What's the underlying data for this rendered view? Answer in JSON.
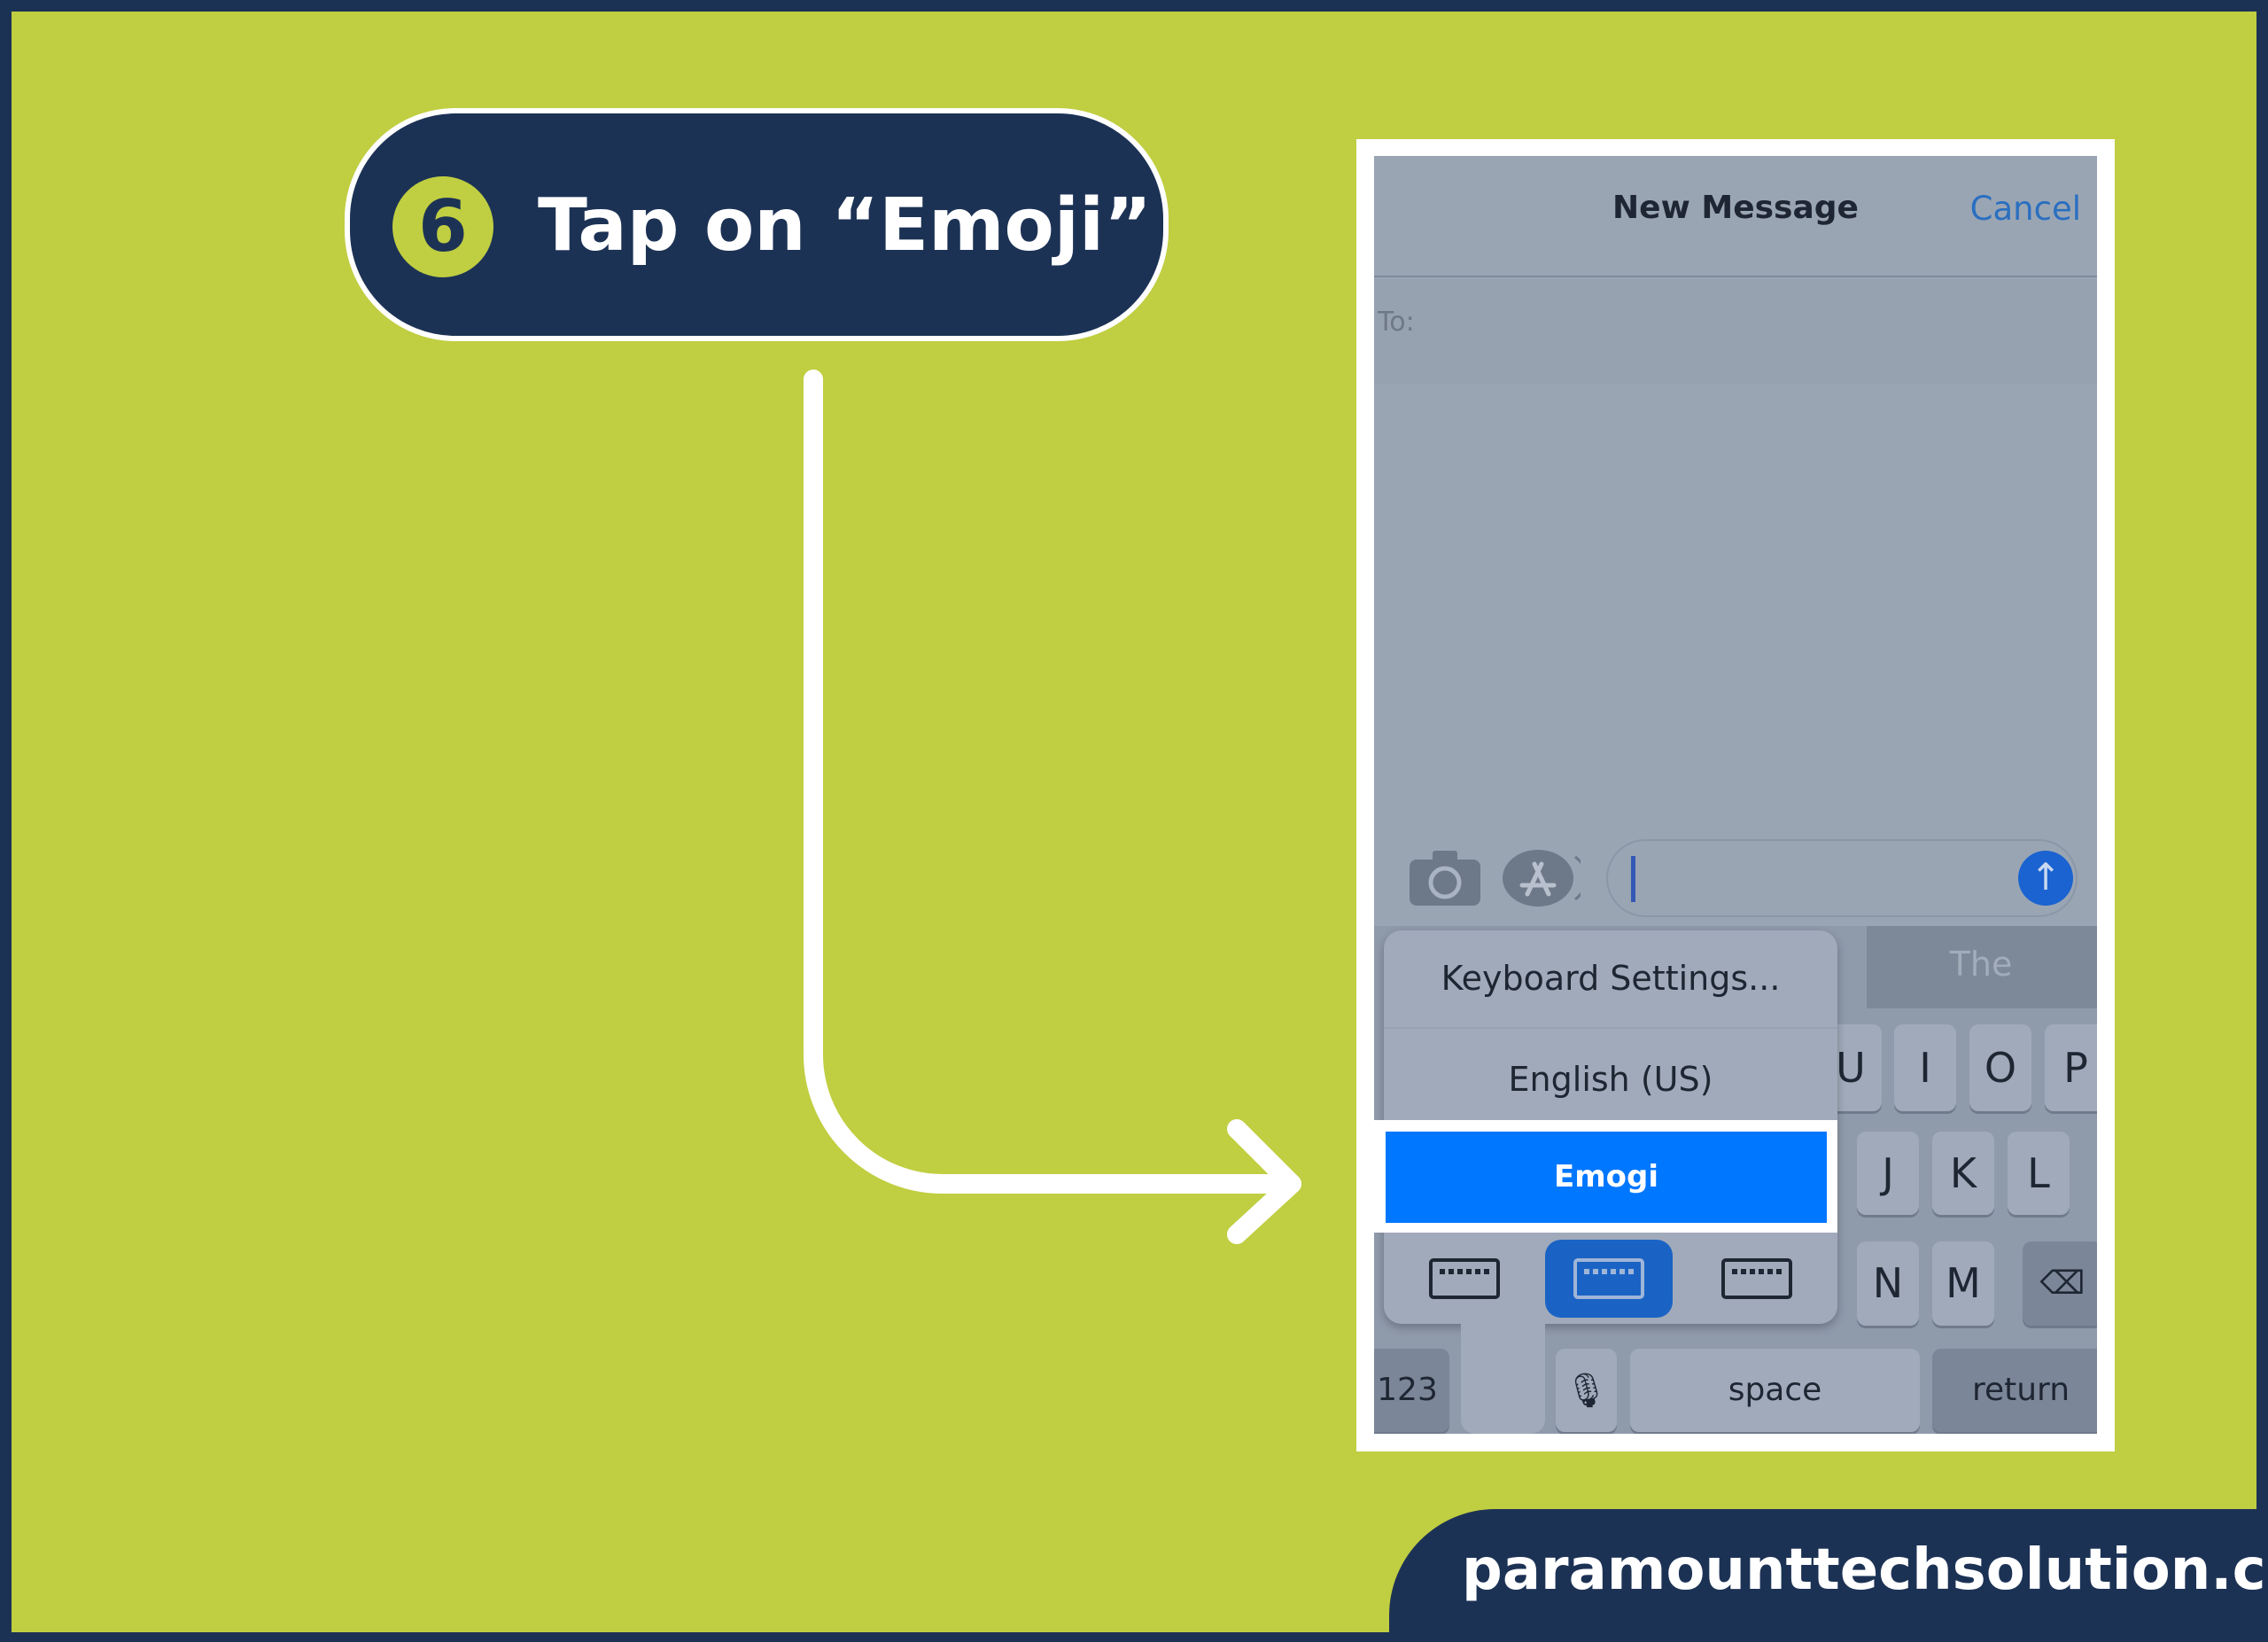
{
  "colors": {
    "background": "#c0ce41",
    "navy": "#1c3255",
    "highlight": "#0077ff"
  },
  "step": {
    "number": "6",
    "instruction": "Tap on “Emoji”"
  },
  "phone": {
    "header": {
      "title": "New Message",
      "cancel": "Cancel"
    },
    "to_label": "To:",
    "icons": [
      "camera-icon",
      "app-store-icon",
      "send-arrow-icon"
    ],
    "suggestion": "The",
    "popup": {
      "items": [
        "Keyboard Settings...",
        "English (US)",
        "Emogi"
      ],
      "icons": [
        "keyboard-left-icon",
        "keyboard-center-icon",
        "keyboard-right-icon"
      ]
    },
    "keys": {
      "row1": [
        "U",
        "I",
        "O",
        "P"
      ],
      "row2": [
        "J",
        "K",
        "L"
      ],
      "row3": [
        "N",
        "M"
      ],
      "numbers": "123",
      "space": "space",
      "return": "return"
    }
  },
  "footer": {
    "website": "paramounttechsolution.com"
  }
}
